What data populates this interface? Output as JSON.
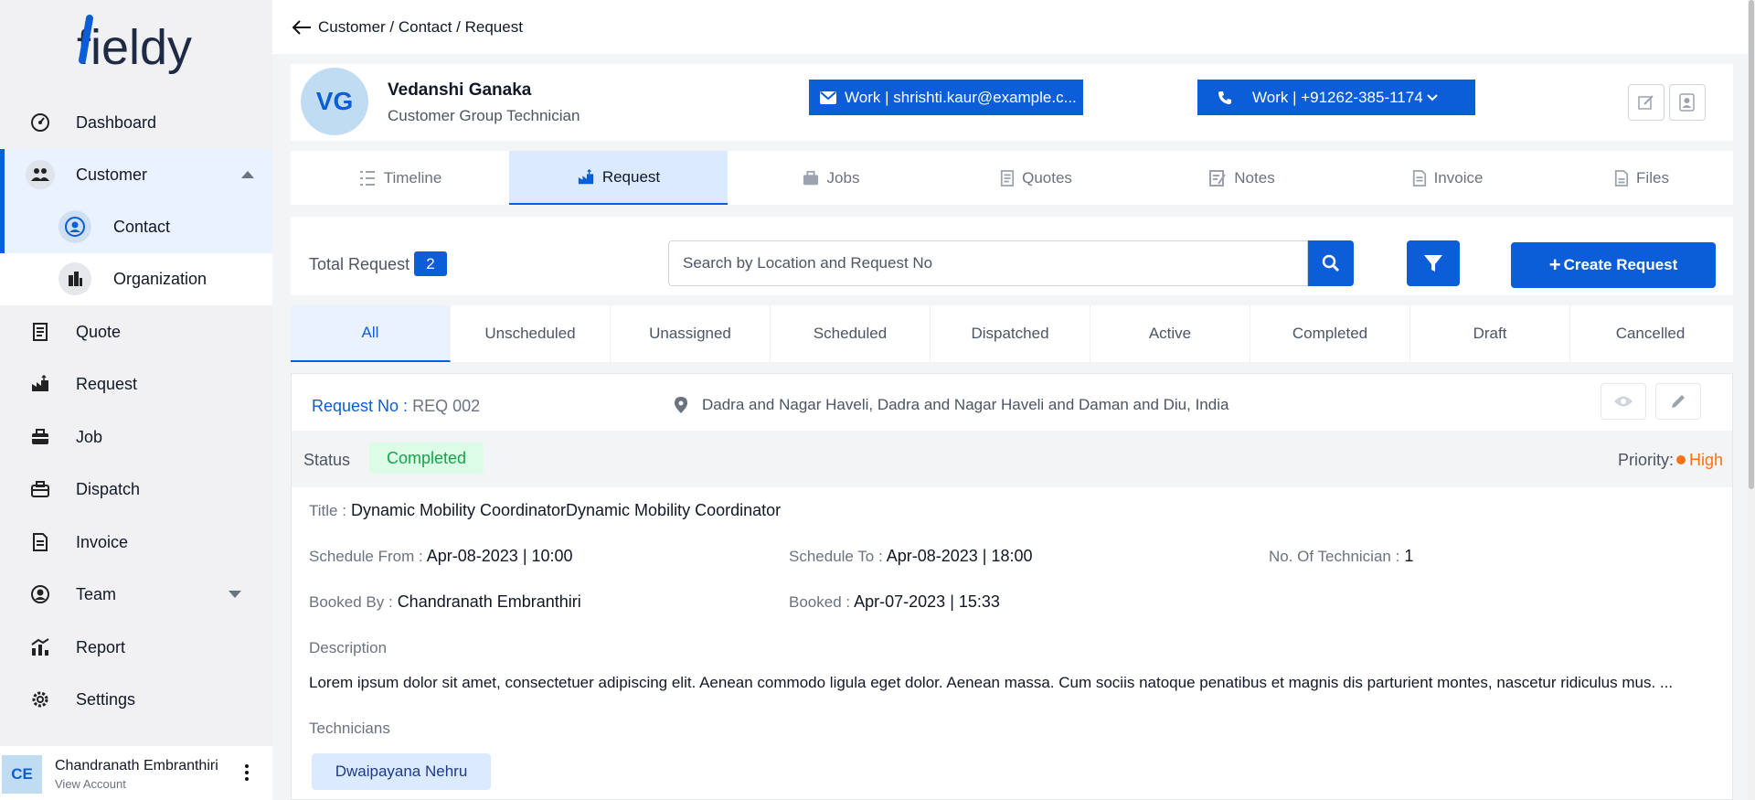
{
  "sidebar": {
    "logo": "fieldy",
    "items": [
      {
        "label": "Dashboard",
        "icon": "dashboard-icon"
      },
      {
        "label": "Customer",
        "icon": "customer-icon"
      },
      {
        "label": "Contact",
        "icon": "contact-icon"
      },
      {
        "label": "Organization",
        "icon": "organization-icon"
      },
      {
        "label": "Quote",
        "icon": "quote-icon"
      },
      {
        "label": "Request",
        "icon": "request-icon"
      },
      {
        "label": "Job",
        "icon": "job-icon"
      },
      {
        "label": "Dispatch",
        "icon": "dispatch-icon"
      },
      {
        "label": "Invoice",
        "icon": "invoice-icon"
      },
      {
        "label": "Team",
        "icon": "team-icon"
      },
      {
        "label": "Report",
        "icon": "report-icon"
      },
      {
        "label": "Settings",
        "icon": "settings-icon"
      }
    ],
    "account": {
      "initials": "CE",
      "name": "Chandranath Embranthiri",
      "link": "View Account"
    }
  },
  "header": {
    "breadcrumb": "Customer / Contact / Request"
  },
  "profile": {
    "initials": "VG",
    "name": "Vedanshi Ganaka",
    "role": "Customer Group Technician",
    "email": "Work | shrishti.kaur@example.c...",
    "phone": "Work | +91262-385-1174"
  },
  "tabs": [
    {
      "label": "Timeline",
      "icon": "timeline-icon"
    },
    {
      "label": "Request",
      "icon": "request-icon"
    },
    {
      "label": "Jobs",
      "icon": "jobs-icon"
    },
    {
      "label": "Quotes",
      "icon": "quotes-icon"
    },
    {
      "label": "Notes",
      "icon": "notes-icon"
    },
    {
      "label": "Invoice",
      "icon": "invoice-icon"
    },
    {
      "label": "Files",
      "icon": "files-icon"
    }
  ],
  "toolbar": {
    "total_label": "Total Request",
    "total_count": "2",
    "search_placeholder": "Search by Location and Request No",
    "create_label": "Create Request"
  },
  "status_tabs": [
    "All",
    "Unscheduled",
    "Unassigned",
    "Scheduled",
    "Dispatched",
    "Active",
    "Completed",
    "Draft",
    "Cancelled"
  ],
  "request": {
    "no_label": "Request No :",
    "no_value": "REQ 002",
    "location": "Dadra and Nagar Haveli, Dadra and Nagar Haveli and Daman and Diu, India",
    "status_label": "Status",
    "status_value": "Completed",
    "priority_label": "Priority:",
    "priority_value": "High",
    "title_label": "Title :",
    "title_value": "Dynamic Mobility CoordinatorDynamic Mobility Coordinator",
    "schedule_from_label": "Schedule From :",
    "schedule_from_value": "Apr-08-2023 | 10:00",
    "schedule_to_label": "Schedule To :",
    "schedule_to_value": "Apr-08-2023 | 18:00",
    "technicians_count_label": "No. Of Technician :",
    "technicians_count_value": "1",
    "booked_by_label": "Booked By :",
    "booked_by_value": "Chandranath Embranthiri",
    "booked_label": "Booked :",
    "booked_value": "Apr-07-2023 | 15:33",
    "description_label": "Description",
    "description": "Lorem ipsum dolor sit amet, consectetuer adipiscing elit. Aenean commodo ligula eget dolor. Aenean massa. Cum sociis natoque penatibus et magnis dis parturient montes, nascetur ridiculus mus. ...",
    "technicians_label": "Technicians",
    "technicians": [
      "Dwaipayana Nehru"
    ]
  },
  "colors": {
    "primary": "#0b5ed7",
    "success": "#16a34a",
    "warning": "#f97316"
  }
}
